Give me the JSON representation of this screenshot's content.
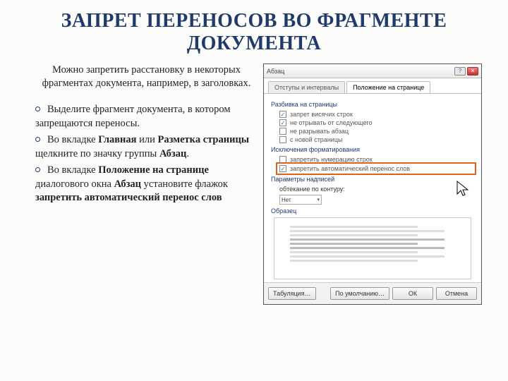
{
  "title": "ЗАПРЕТ ПЕРЕНОСОВ ВО ФРАГМЕНТЕ ДОКУМЕНТА",
  "intro": "Можно запретить расстановку в некоторых фрагментах документа, например, в заголовках.",
  "steps": [
    {
      "pre": "Выделите фрагмент документа, в котором запрещаются переносы."
    },
    {
      "pre": "Во вкладке ",
      "b1": "Главная",
      "mid1": " или ",
      "b2": "Разметка страницы",
      "mid2": " щелкните по значку группы ",
      "b3": "Абзац",
      "post": "."
    },
    {
      "pre": "Во вкладке ",
      "b1": "Положение на странице",
      "mid1": " диалогового окна ",
      "b2": "Абзац",
      "mid2": " установите флажок ",
      "b3": "запретить автоматический перенос слов",
      "post": ""
    }
  ],
  "dialog": {
    "title": "Абзац",
    "tabs": [
      "Отступы и интервалы",
      "Положение на странице"
    ],
    "section1": "Разбивка на страницы",
    "checks1": [
      {
        "on": true,
        "label": "запрет висячих строк"
      },
      {
        "on": true,
        "label": "не отрывать от следующего"
      },
      {
        "on": false,
        "label": "не разрывать абзац"
      },
      {
        "on": false,
        "label": "с новой страницы"
      }
    ],
    "section2": "Исключения форматирования",
    "checks2": [
      {
        "on": false,
        "label": "запретить нумерацию строк"
      },
      {
        "on": true,
        "label": "запретить автоматический перенос слов",
        "hl": true
      }
    ],
    "section3": "Параметры надписей",
    "dd_label": "обтекание по контуру:",
    "dd_value": "Нет",
    "section4": "Образец",
    "buttons": {
      "tabs": "Табуляция…",
      "default": "По умолчанию…",
      "ok": "ОК",
      "cancel": "Отмена"
    }
  }
}
